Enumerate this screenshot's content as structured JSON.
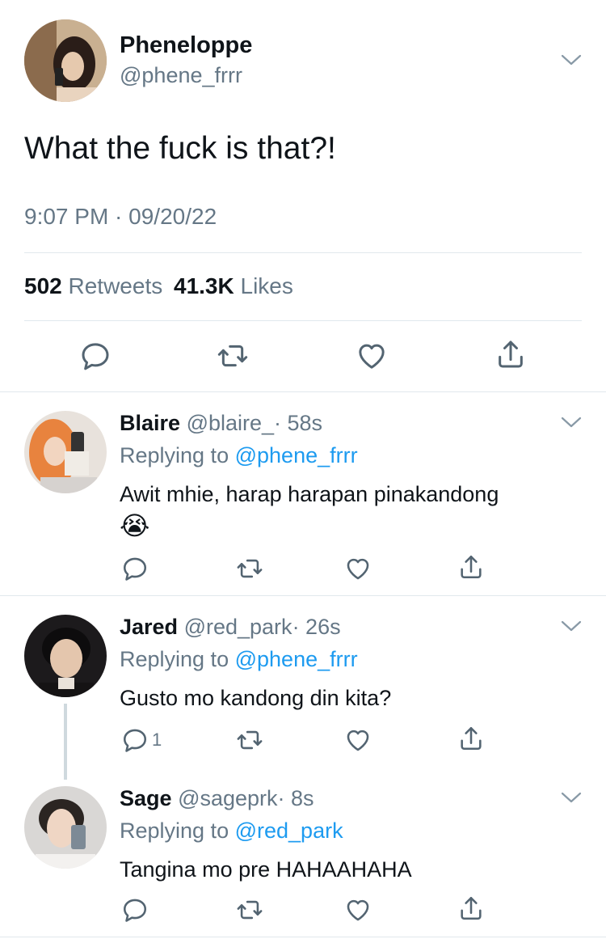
{
  "main_tweet": {
    "display_name": "Pheneloppe",
    "handle": "@phene_frrr",
    "text": "What the fuck is that?!",
    "timestamp": "9:07 PM · 09/20/22",
    "retweets_count": "502",
    "retweets_label": "Retweets",
    "likes_count": "41.3K",
    "likes_label": "Likes"
  },
  "replies": [
    {
      "display_name": "Blaire",
      "handle": "@blaire_",
      "time": "· 58s",
      "replying_prefix": "Replying to",
      "replying_to": "@phene_frrr",
      "text": "Awit mhie, harap harapan pinakandong",
      "emoji": "😭",
      "reply_count": ""
    },
    {
      "display_name": "Jared",
      "handle": "@red_park",
      "time": "· 26s",
      "replying_prefix": "Replying to",
      "replying_to": "@phene_frrr",
      "text": "Gusto mo kandong din kita?",
      "reply_count": "1"
    },
    {
      "display_name": "Sage",
      "handle": "@sageprk",
      "time": "· 8s",
      "replying_prefix": "Replying to",
      "replying_to": "@red_park",
      "text": "Tangina mo pre HAHAAHAHA",
      "reply_count": ""
    }
  ],
  "icons": {
    "reply": "reply-icon",
    "retweet": "retweet-icon",
    "like": "heart-icon",
    "share": "share-icon",
    "more": "chevron-down-icon"
  },
  "colors": {
    "text": "#0f1419",
    "secondary": "#657786",
    "link": "#1d9bf0",
    "divider": "#e1e8ed"
  }
}
